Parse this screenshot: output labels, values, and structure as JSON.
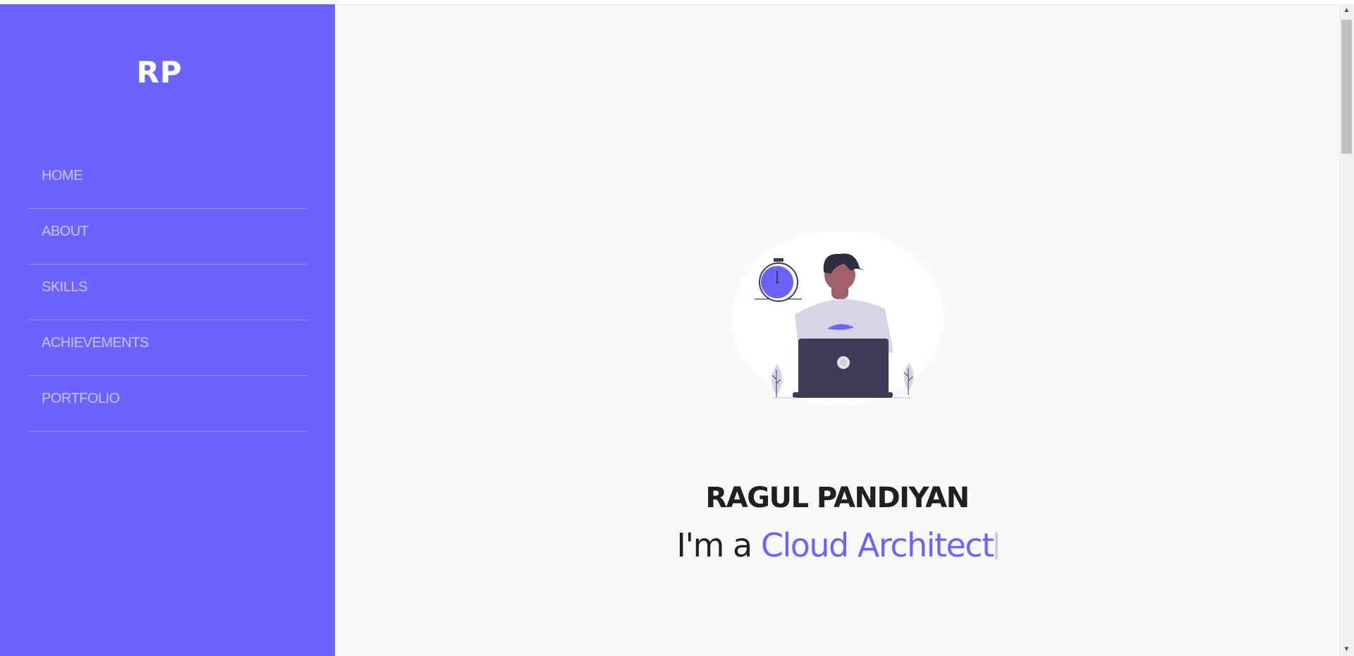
{
  "brand": "RP",
  "nav": [
    {
      "label": "HOME"
    },
    {
      "label": "ABOUT"
    },
    {
      "label": "SKILLS"
    },
    {
      "label": "ACHIEVEMENTS"
    },
    {
      "label": "PORTFOLIO"
    }
  ],
  "hero": {
    "name": "RAGUL PANDIYAN",
    "prefix": "I'm a",
    "role": "Cloud Architect"
  },
  "colors": {
    "accent": "#6c63ff",
    "background": "#f8f9fb",
    "text": "#1f1f24"
  },
  "icons": {
    "illustration": "developer-with-laptop-illustration",
    "scroll_up": "triangle-up",
    "scroll_down": "triangle-down"
  }
}
